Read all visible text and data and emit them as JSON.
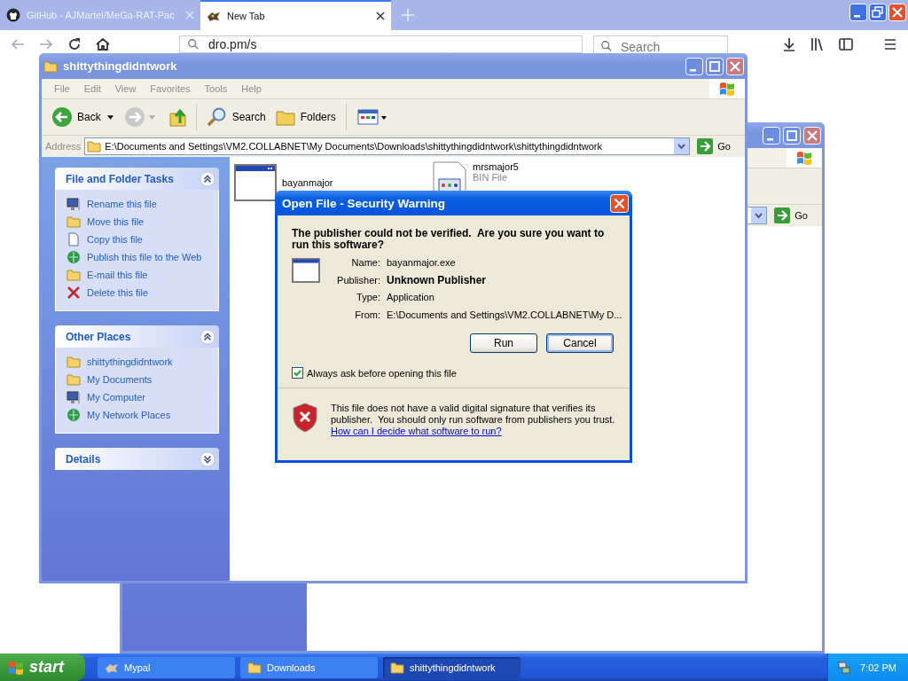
{
  "browser": {
    "tabs": [
      {
        "label": "GitHub - AJMartel/MeGa-RAT-Pac",
        "selected": false
      },
      {
        "label": "New Tab",
        "selected": true
      }
    ],
    "url": "dro.pm/s",
    "search": {
      "placeholder": "Search"
    }
  },
  "back_window": {
    "go": "Go"
  },
  "explorer": {
    "title": "shittythingdidntwork",
    "menu": [
      "File",
      "Edit",
      "View",
      "Favorites",
      "Tools",
      "Help"
    ],
    "toolbar": {
      "back": "Back",
      "search": "Search",
      "folders": "Folders"
    },
    "address_label": "Address",
    "address": "E:\\Documents and Settings\\VM2.COLLABNET\\My Documents\\Downloads\\shittythingdidntwork\\shittythingdidntwork",
    "go": "Go",
    "panels": [
      {
        "title": "File and Folder Tasks",
        "expanded": true,
        "items": [
          {
            "label": "Rename this file",
            "kind": "screen"
          },
          {
            "label": "Move this file",
            "kind": "folder"
          },
          {
            "label": "Copy this file",
            "kind": "doc"
          },
          {
            "label": "Publish this file to the Web",
            "kind": "globe"
          },
          {
            "label": "E-mail this file",
            "kind": "folder"
          },
          {
            "label": "Delete this file",
            "kind": "cross"
          }
        ]
      },
      {
        "title": "Other Places",
        "expanded": true,
        "items": [
          {
            "label": "shittythingdidntwork",
            "kind": "folder"
          },
          {
            "label": "My Documents",
            "kind": "folder"
          },
          {
            "label": "My Computer",
            "kind": "screen"
          },
          {
            "label": "My Network Places",
            "kind": "globe"
          }
        ]
      },
      {
        "title": "Details",
        "expanded": false
      }
    ],
    "files": [
      {
        "name": "bayanmajor",
        "kind": "exe"
      },
      {
        "name": "mrsmajor5",
        "type": "BIN File",
        "kind": "bin"
      }
    ]
  },
  "dialog": {
    "title": "Open File - Security Warning",
    "question": "The publisher could not be verified.  Are you sure you want to run this software?",
    "fields": [
      {
        "label": "Name:",
        "value": "bayanmajor.exe",
        "bold": false
      },
      {
        "label": "Publisher:",
        "value": "Unknown Publisher",
        "bold": true
      },
      {
        "label": "Type:",
        "value": "Application",
        "bold": false
      },
      {
        "label": "From:",
        "value": "E:\\Documents and Settings\\VM2.COLLABNET\\My D...",
        "bold": false
      }
    ],
    "buttons": [
      {
        "label": "Run",
        "default": false
      },
      {
        "label": "Cancel",
        "default": true
      }
    ],
    "always_ask": {
      "label": "Always ask before opening this file",
      "checked": true
    },
    "warning": "This file does not have a valid digital signature that verifies its publisher.  You should only run software from publishers you trust.",
    "link": "How can I decide what software to run?"
  },
  "taskbar": {
    "start": "start",
    "tasks": [
      {
        "label": "Mypal",
        "kind": "app",
        "selected": false
      },
      {
        "label": "Downloads",
        "kind": "folder",
        "selected": false
      },
      {
        "label": "shittythingdidntwork",
        "kind": "folder",
        "selected": true
      }
    ],
    "clock": "7:02 PM"
  }
}
